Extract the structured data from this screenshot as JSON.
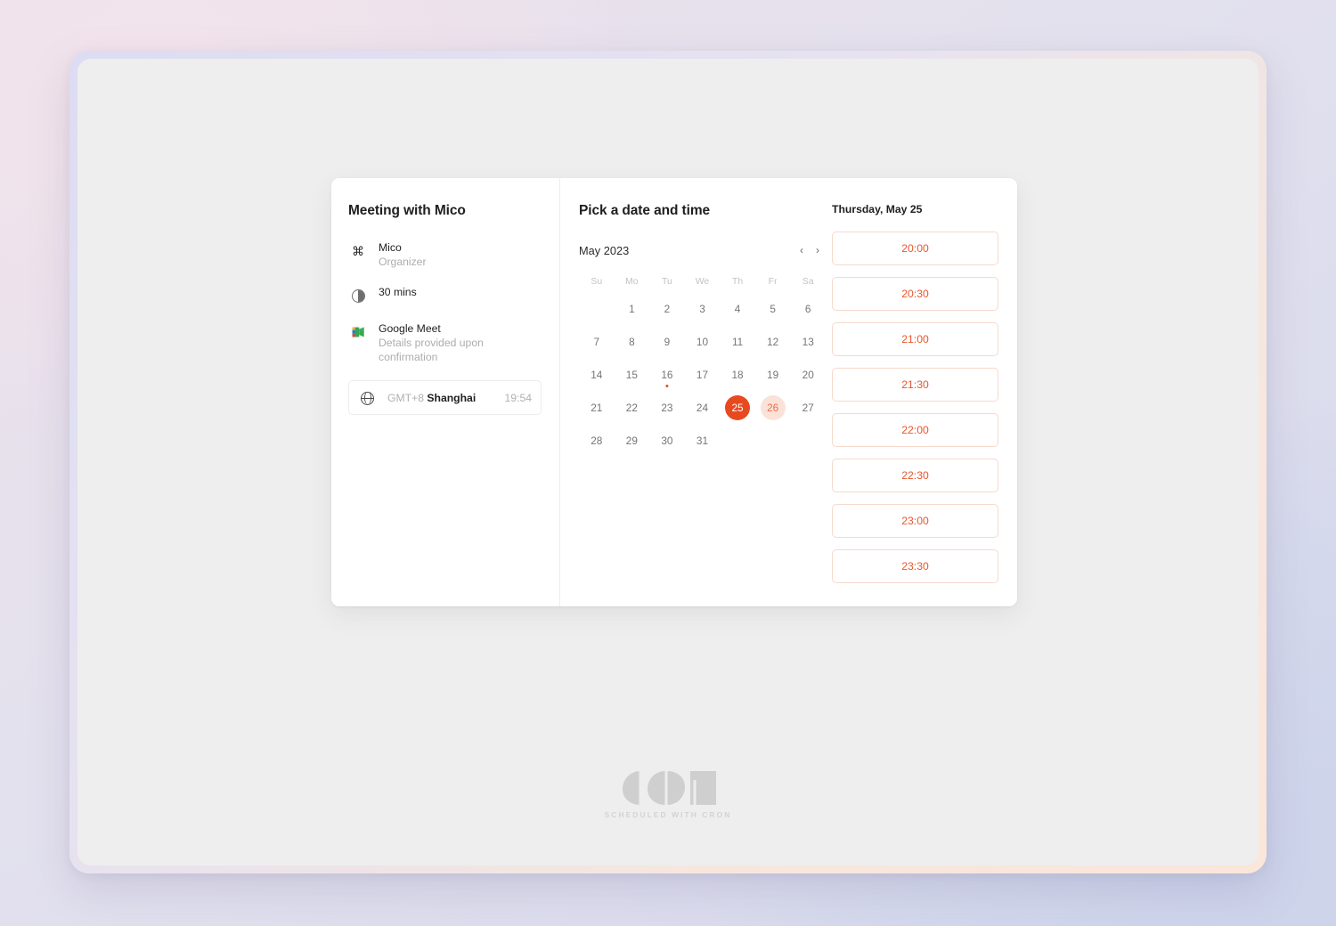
{
  "meeting": {
    "title": "Meeting with Mico",
    "organizer": {
      "name": "Mico",
      "role": "Organizer",
      "icon": "command-icon"
    },
    "duration": {
      "label": "30 mins",
      "icon": "half-circle-clock-icon"
    },
    "location": {
      "name": "Google Meet",
      "detail": "Details provided upon confirmation",
      "icon": "google-meet-icon"
    },
    "timezone": {
      "icon": "globe-icon",
      "offset": "GMT+8",
      "city": "Shanghai",
      "current_time": "19:54"
    }
  },
  "picker": {
    "title": "Pick a date and time",
    "month_label": "May 2023",
    "prev_label": "‹",
    "next_label": "›",
    "weekdays": [
      "Su",
      "Mo",
      "Tu",
      "We",
      "Th",
      "Fr",
      "Sa"
    ],
    "leading_blanks": 1,
    "days": [
      {
        "n": "1"
      },
      {
        "n": "2"
      },
      {
        "n": "3"
      },
      {
        "n": "4"
      },
      {
        "n": "5"
      },
      {
        "n": "6"
      },
      {
        "n": "7"
      },
      {
        "n": "8"
      },
      {
        "n": "9"
      },
      {
        "n": "10"
      },
      {
        "n": "11"
      },
      {
        "n": "12"
      },
      {
        "n": "13"
      },
      {
        "n": "14"
      },
      {
        "n": "15"
      },
      {
        "n": "16",
        "today": true
      },
      {
        "n": "17"
      },
      {
        "n": "18"
      },
      {
        "n": "19"
      },
      {
        "n": "20"
      },
      {
        "n": "21"
      },
      {
        "n": "22"
      },
      {
        "n": "23"
      },
      {
        "n": "24"
      },
      {
        "n": "25",
        "selected": true
      },
      {
        "n": "26",
        "highlighted": true
      },
      {
        "n": "27"
      },
      {
        "n": "28"
      },
      {
        "n": "29"
      },
      {
        "n": "30"
      },
      {
        "n": "31"
      }
    ]
  },
  "slots": {
    "date_label": "Thursday, May 25",
    "times": [
      "20:00",
      "20:30",
      "21:00",
      "21:30",
      "22:00",
      "22:30",
      "23:00",
      "23:30"
    ]
  },
  "footer": {
    "brand": "cron",
    "tagline": "SCHEDULED WITH CRON"
  },
  "colors": {
    "accent": "#e8491f",
    "accent_text": "#e8562c",
    "slot_border": "#f6d9cb",
    "highlight_bg": "#fbe2d9"
  }
}
